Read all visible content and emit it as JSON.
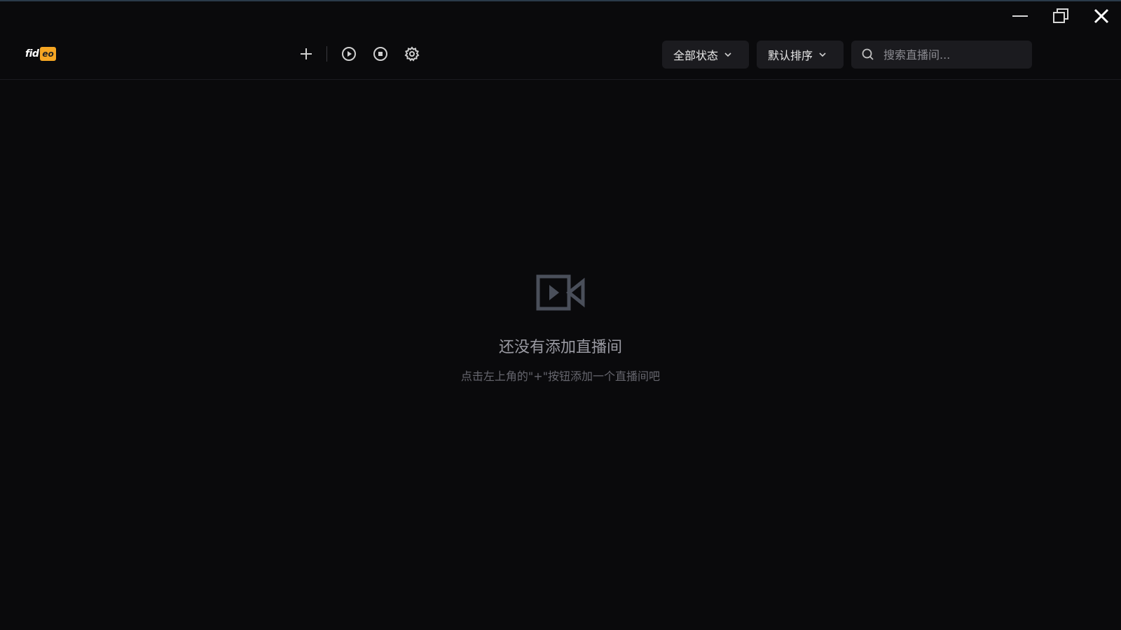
{
  "app": {
    "logo_text": "fid",
    "logo_badge": "eo"
  },
  "window_controls": {
    "icons": [
      "minimize-icon",
      "restore-icon",
      "close-icon"
    ]
  },
  "toolbar": {
    "icons": [
      "plus-icon",
      "play-circle-icon",
      "stop-circle-icon",
      "gear-icon"
    ],
    "status_filter": {
      "selected": "全部状态"
    },
    "sort": {
      "selected": "默认排序"
    },
    "search": {
      "placeholder": "搜索直播间...",
      "value": ""
    }
  },
  "empty_state": {
    "icon": "video-camera-icon",
    "title": "还没有添加直播间",
    "hint": "点击左上角的\"+\"按钮添加一个直播间吧"
  },
  "colors": {
    "background": "#0a0a0c",
    "control_bg": "#1b1b1f",
    "accent": "#f5a623",
    "icon_muted": "#4a4f5a"
  }
}
